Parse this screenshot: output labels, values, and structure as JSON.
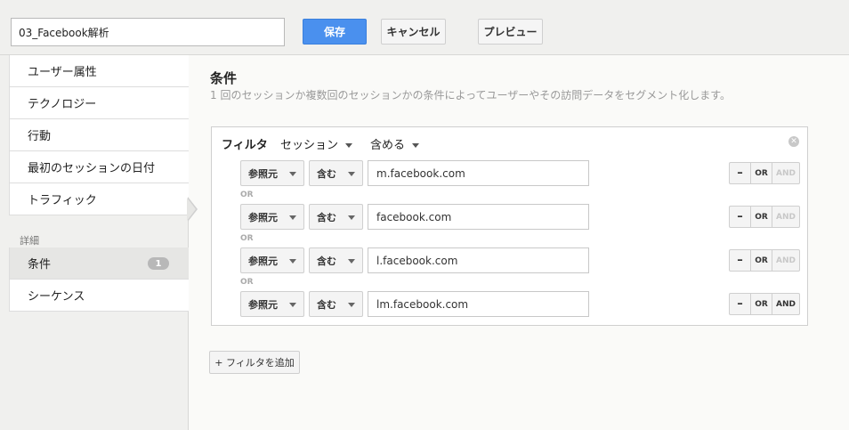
{
  "toolbar": {
    "segment_name": "03_Facebook解析",
    "save_label": "保存",
    "cancel_label": "キャンセル",
    "preview_label": "プレビュー"
  },
  "sidebar": {
    "items": [
      {
        "label": "ユーザー属性"
      },
      {
        "label": "テクノロジー"
      },
      {
        "label": "行動"
      },
      {
        "label": "最初のセッションの日付"
      },
      {
        "label": "トラフィック"
      }
    ],
    "section_label": "詳細",
    "advanced_items": [
      {
        "label": "条件",
        "badge": "1"
      },
      {
        "label": "シーケンス"
      }
    ]
  },
  "main": {
    "title": "条件",
    "subtitle": "1 回のセッションか複数回のセッションかの条件によってユーザーやその訪問データをセグメント化します。",
    "filter": {
      "label": "フィルタ",
      "scope": "セッション",
      "mode": "含める",
      "close_icon": "close-icon",
      "rows": [
        {
          "dimension": "参照元",
          "operator": "含む",
          "value": "m.facebook.com",
          "minus": "–",
          "or": "OR",
          "and": "AND"
        },
        {
          "dimension": "参照元",
          "operator": "含む",
          "value": "facebook.com",
          "minus": "–",
          "or": "OR",
          "and": "AND"
        },
        {
          "dimension": "参照元",
          "operator": "含む",
          "value": "l.facebook.com",
          "minus": "–",
          "or": "OR",
          "and": "AND"
        },
        {
          "dimension": "参照元",
          "operator": "含む",
          "value": "lm.facebook.com",
          "minus": "–",
          "or": "OR",
          "and": "AND"
        }
      ],
      "or_separator": "OR"
    },
    "add_filter_label": "+ フィルタを追加"
  },
  "colors": {
    "save_button": "#4a90ee",
    "sidebar_bg": "#f0f0ee"
  }
}
